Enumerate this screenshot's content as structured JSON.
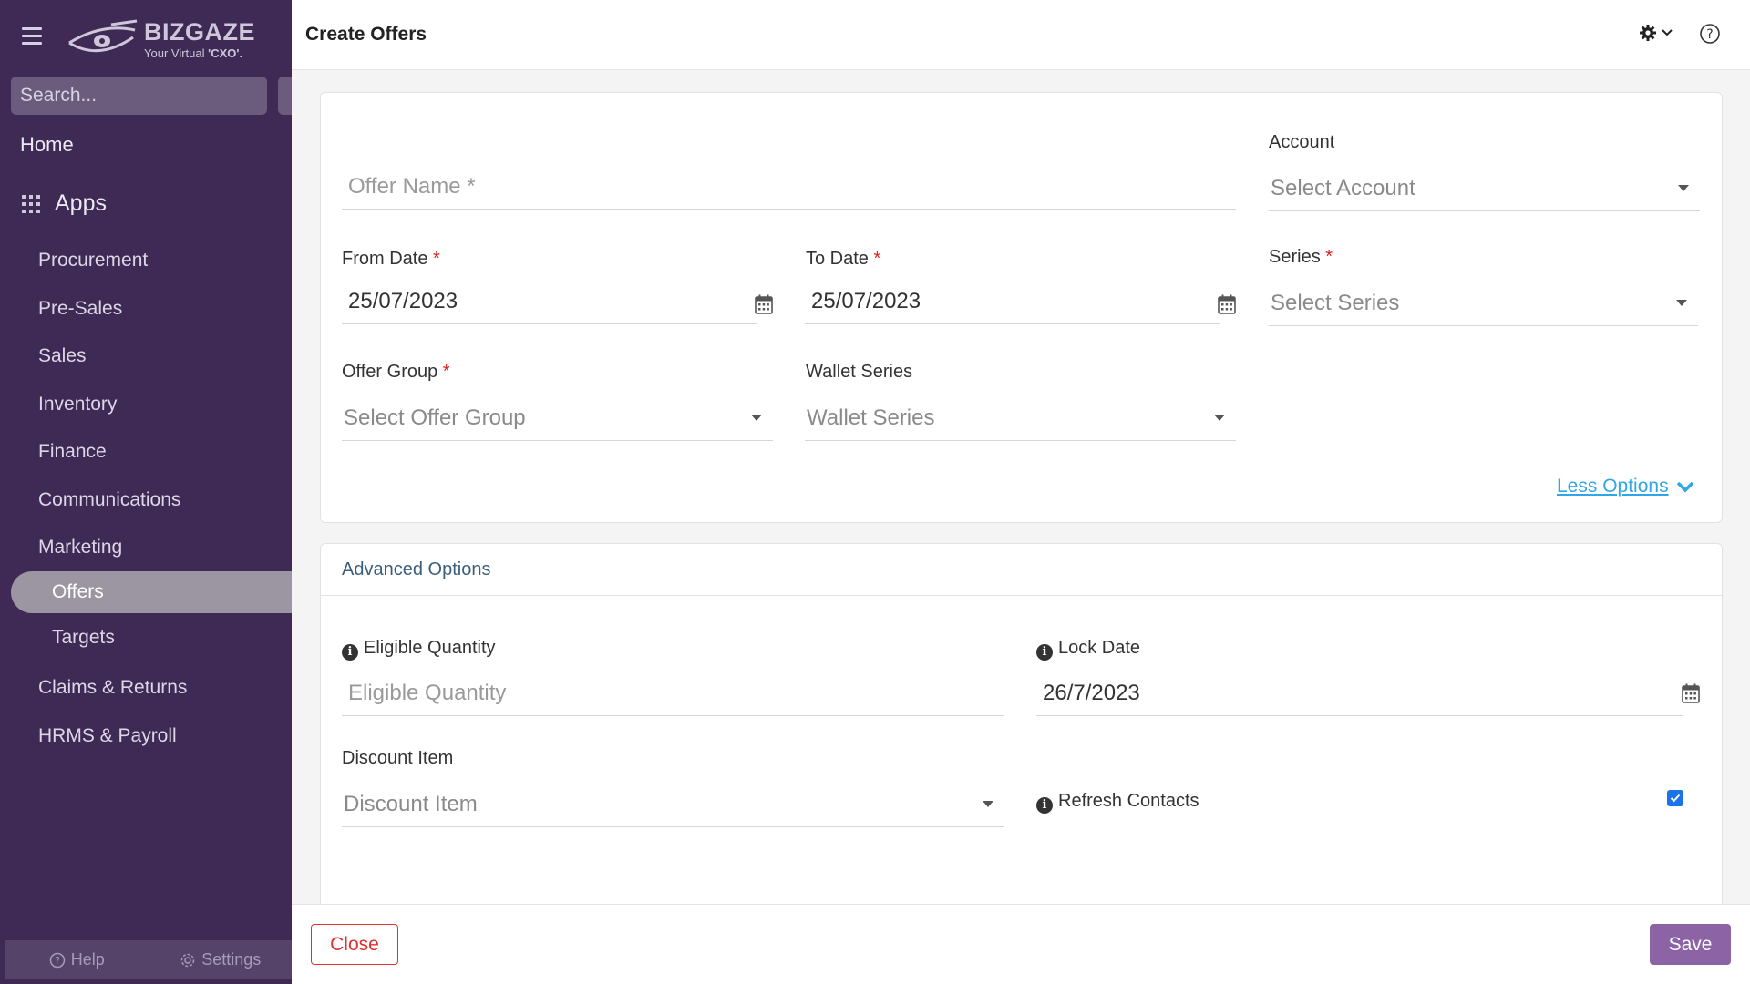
{
  "sidebar": {
    "logo": {
      "brand": "BIZGAZE",
      "tagline_prefix": "Your Virtual ",
      "tagline_bold": "'CXO'."
    },
    "search_placeholder": "Search...",
    "home": "Home",
    "apps": "Apps",
    "items": [
      {
        "label": "Procurement"
      },
      {
        "label": "Pre-Sales"
      },
      {
        "label": "Sales"
      },
      {
        "label": "Inventory"
      },
      {
        "label": "Finance"
      },
      {
        "label": "Communications"
      },
      {
        "label": "Marketing"
      },
      {
        "label": "Claims & Returns"
      },
      {
        "label": "HRMS & Payroll"
      }
    ],
    "marketing_sub": [
      {
        "label": "Offers",
        "active": true
      },
      {
        "label": "Targets",
        "active": false
      }
    ],
    "footer": {
      "help": "Help",
      "settings": "Settings"
    }
  },
  "header": {
    "title": "Create Offers"
  },
  "form": {
    "offer_name_placeholder": "Offer Name *",
    "account_label": "Account",
    "account_placeholder": "Select Account",
    "from_date_label": "From Date",
    "from_date_value": "25/07/2023",
    "to_date_label": "To Date",
    "to_date_value": "25/07/2023",
    "series_label": "Series",
    "series_placeholder": "Select Series",
    "offer_group_label": "Offer Group",
    "offer_group_placeholder": "Select Offer Group",
    "wallet_series_label": "Wallet Series",
    "wallet_series_placeholder": "Wallet Series",
    "less_options": "Less Options",
    "required_mark": "*"
  },
  "advanced": {
    "title": "Advanced Options",
    "eligible_quantity_label": "Eligible Quantity",
    "eligible_quantity_placeholder": "Eligible Quantity",
    "lock_date_label": "Lock Date",
    "lock_date_value": "26/7/2023",
    "discount_item_label": "Discount Item",
    "discount_item_placeholder": "Discount Item",
    "refresh_contacts_label": "Refresh Contacts",
    "refresh_contacts_checked": true
  },
  "actions": {
    "close": "Close",
    "save": "Save"
  },
  "colors": {
    "sidebar_bg": "#3f2a56",
    "accent": "#8c64a5",
    "link": "#2fa7e6",
    "danger": "#e0302f",
    "checkbox": "#1a73e8"
  }
}
